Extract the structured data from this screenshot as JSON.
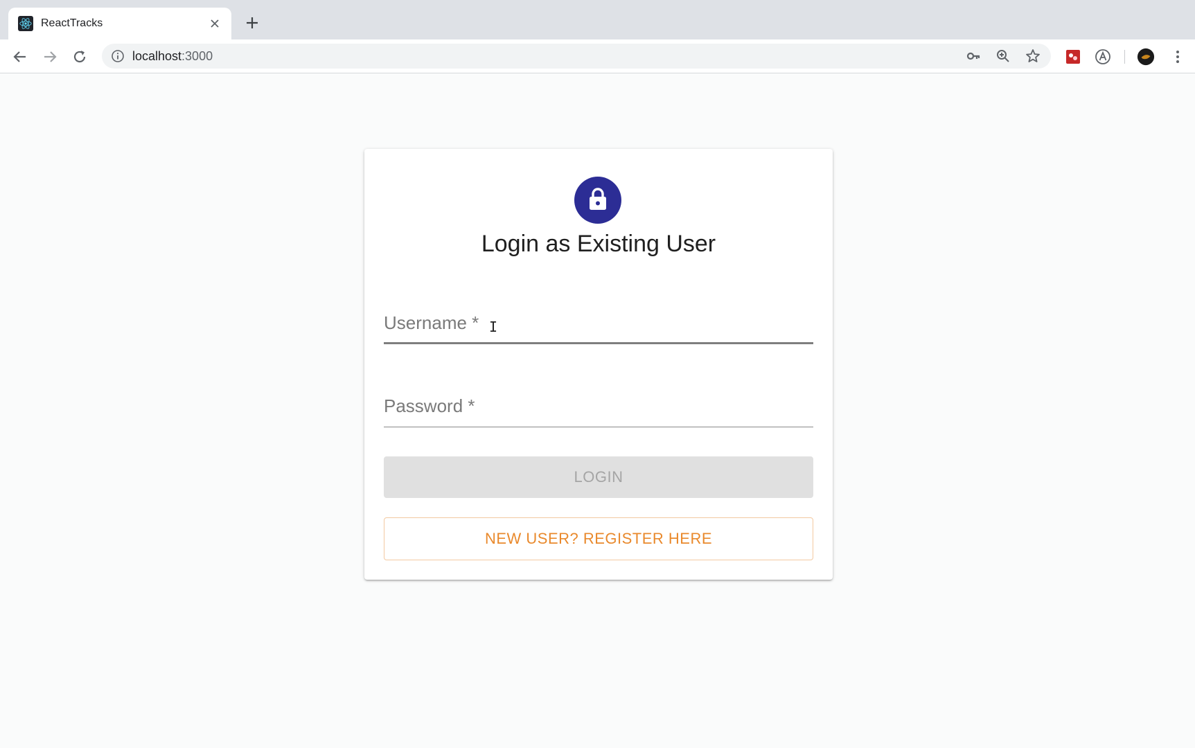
{
  "browser": {
    "tab_title": "ReactTracks",
    "url_host": "localhost",
    "url_port": ":3000"
  },
  "icons": {
    "back": "arrow-left-icon",
    "forward": "arrow-right-icon",
    "reload": "reload-icon",
    "site_info": "info-icon",
    "passwords": "key-icon",
    "zoom": "zoom-icon",
    "bookmark": "star-icon",
    "extension_1": "extension-icon",
    "extension_2": "a-circle-icon",
    "profile": "avatar",
    "menu": "kebab-menu-icon",
    "avatar": "lock-icon"
  },
  "colors": {
    "avatar_bg": "#2c2d95",
    "register_text": "#e9892c",
    "login_disabled_bg": "#e0e0e0"
  },
  "login_form": {
    "title": "Login as Existing User",
    "username_label": "Username *",
    "password_label": "Password *",
    "login_button": "LOGIN",
    "register_button": "NEW USER? REGISTER HERE"
  }
}
